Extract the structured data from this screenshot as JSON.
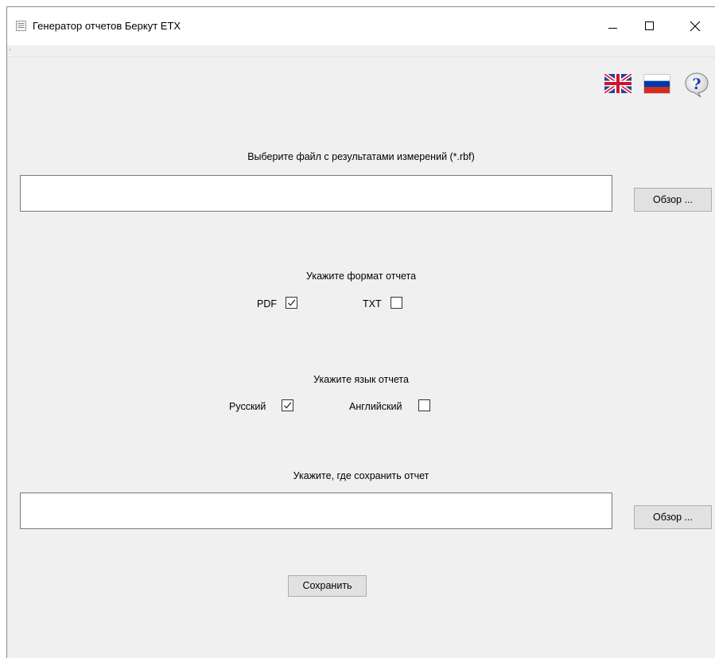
{
  "window": {
    "title": "Генератор отчетов Беркут ETX"
  },
  "toolbar": {
    "flag_en_icon": "uk-flag-icon",
    "flag_ru_icon": "russia-flag-icon",
    "help_icon": "help-question-icon",
    "help_glyph": "?"
  },
  "source": {
    "label": "Выберите файл с результатами измерений (*.rbf)",
    "value": "",
    "browse_label": "Обзор ..."
  },
  "format": {
    "label": "Укажите формат отчета",
    "options": [
      {
        "label": "PDF",
        "checked": true
      },
      {
        "label": "TXT",
        "checked": false
      }
    ]
  },
  "language": {
    "label": "Укажите язык отчета",
    "options": [
      {
        "label": "Русский",
        "checked": true
      },
      {
        "label": "Английский",
        "checked": false
      }
    ]
  },
  "destination": {
    "label": "Укажите, где сохранить отчет",
    "value": "",
    "browse_label": "Обзор ..."
  },
  "save_label": "Сохранить",
  "colors": {
    "window_bg": "#f0f0f0",
    "titlebar_bg": "#ffffff",
    "button_bg": "#e1e1e1",
    "flag_blue": "#0039a6",
    "flag_red": "#d52b1e",
    "help_blue": "#1a3fb8"
  }
}
